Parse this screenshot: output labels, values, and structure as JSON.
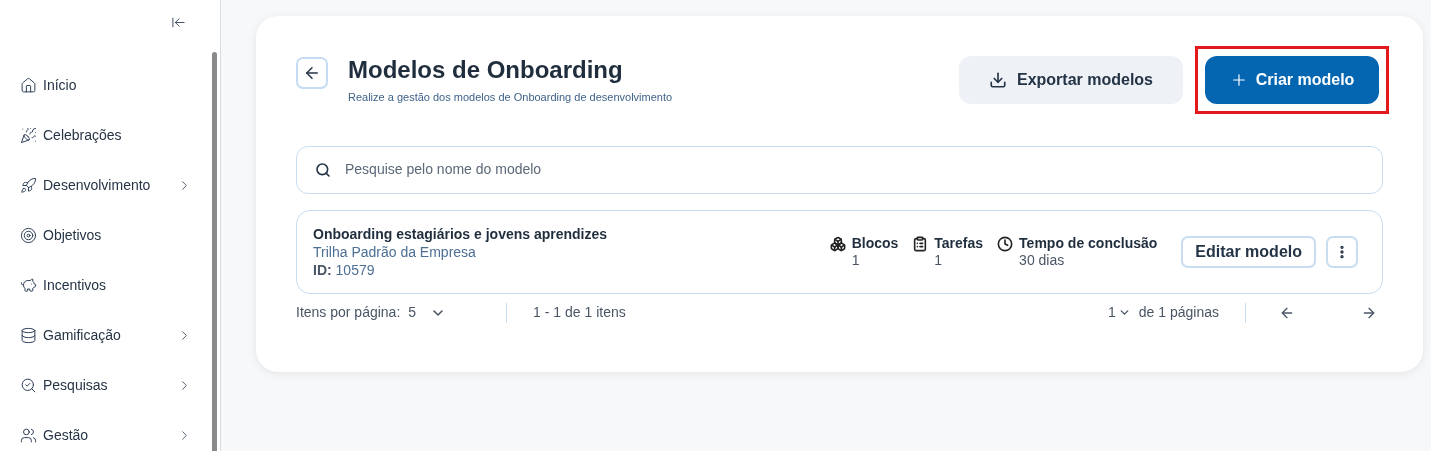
{
  "sidebar": {
    "items": [
      {
        "label": "Início",
        "expandable": false
      },
      {
        "label": "Celebrações",
        "expandable": false
      },
      {
        "label": "Desenvolvimento",
        "expandable": true
      },
      {
        "label": "Objetivos",
        "expandable": false
      },
      {
        "label": "Incentivos",
        "expandable": false
      },
      {
        "label": "Gamificação",
        "expandable": true
      },
      {
        "label": "Pesquisas",
        "expandable": true
      },
      {
        "label": "Gestão",
        "expandable": true
      }
    ]
  },
  "header": {
    "title": "Modelos de Onboarding",
    "subtitle": "Realize a gestão dos modelos de Onboarding de desenvolvimento",
    "export_button": "Exportar modelos",
    "create_button": {
      "label": "Criar modelo",
      "highlighted": true
    }
  },
  "search": {
    "placeholder": "Pesquise pelo nome do modelo"
  },
  "models": [
    {
      "name": "Onboarding estagiários e jovens aprendizes",
      "track": "Trilha Padrão da Empresa",
      "id_label": "ID:",
      "id": "10579",
      "stats": [
        {
          "label": "Blocos",
          "value": "1"
        },
        {
          "label": "Tarefas",
          "value": "1"
        },
        {
          "label": "Tempo de conclusão",
          "value": "30 dias"
        }
      ],
      "edit_button": "Editar modelo"
    }
  ],
  "pagination": {
    "per_page_label": "Itens por página:",
    "per_page": "5",
    "range": "1 - 1 de 1 itens",
    "page": "1",
    "pages_label": "de 1 páginas"
  }
}
